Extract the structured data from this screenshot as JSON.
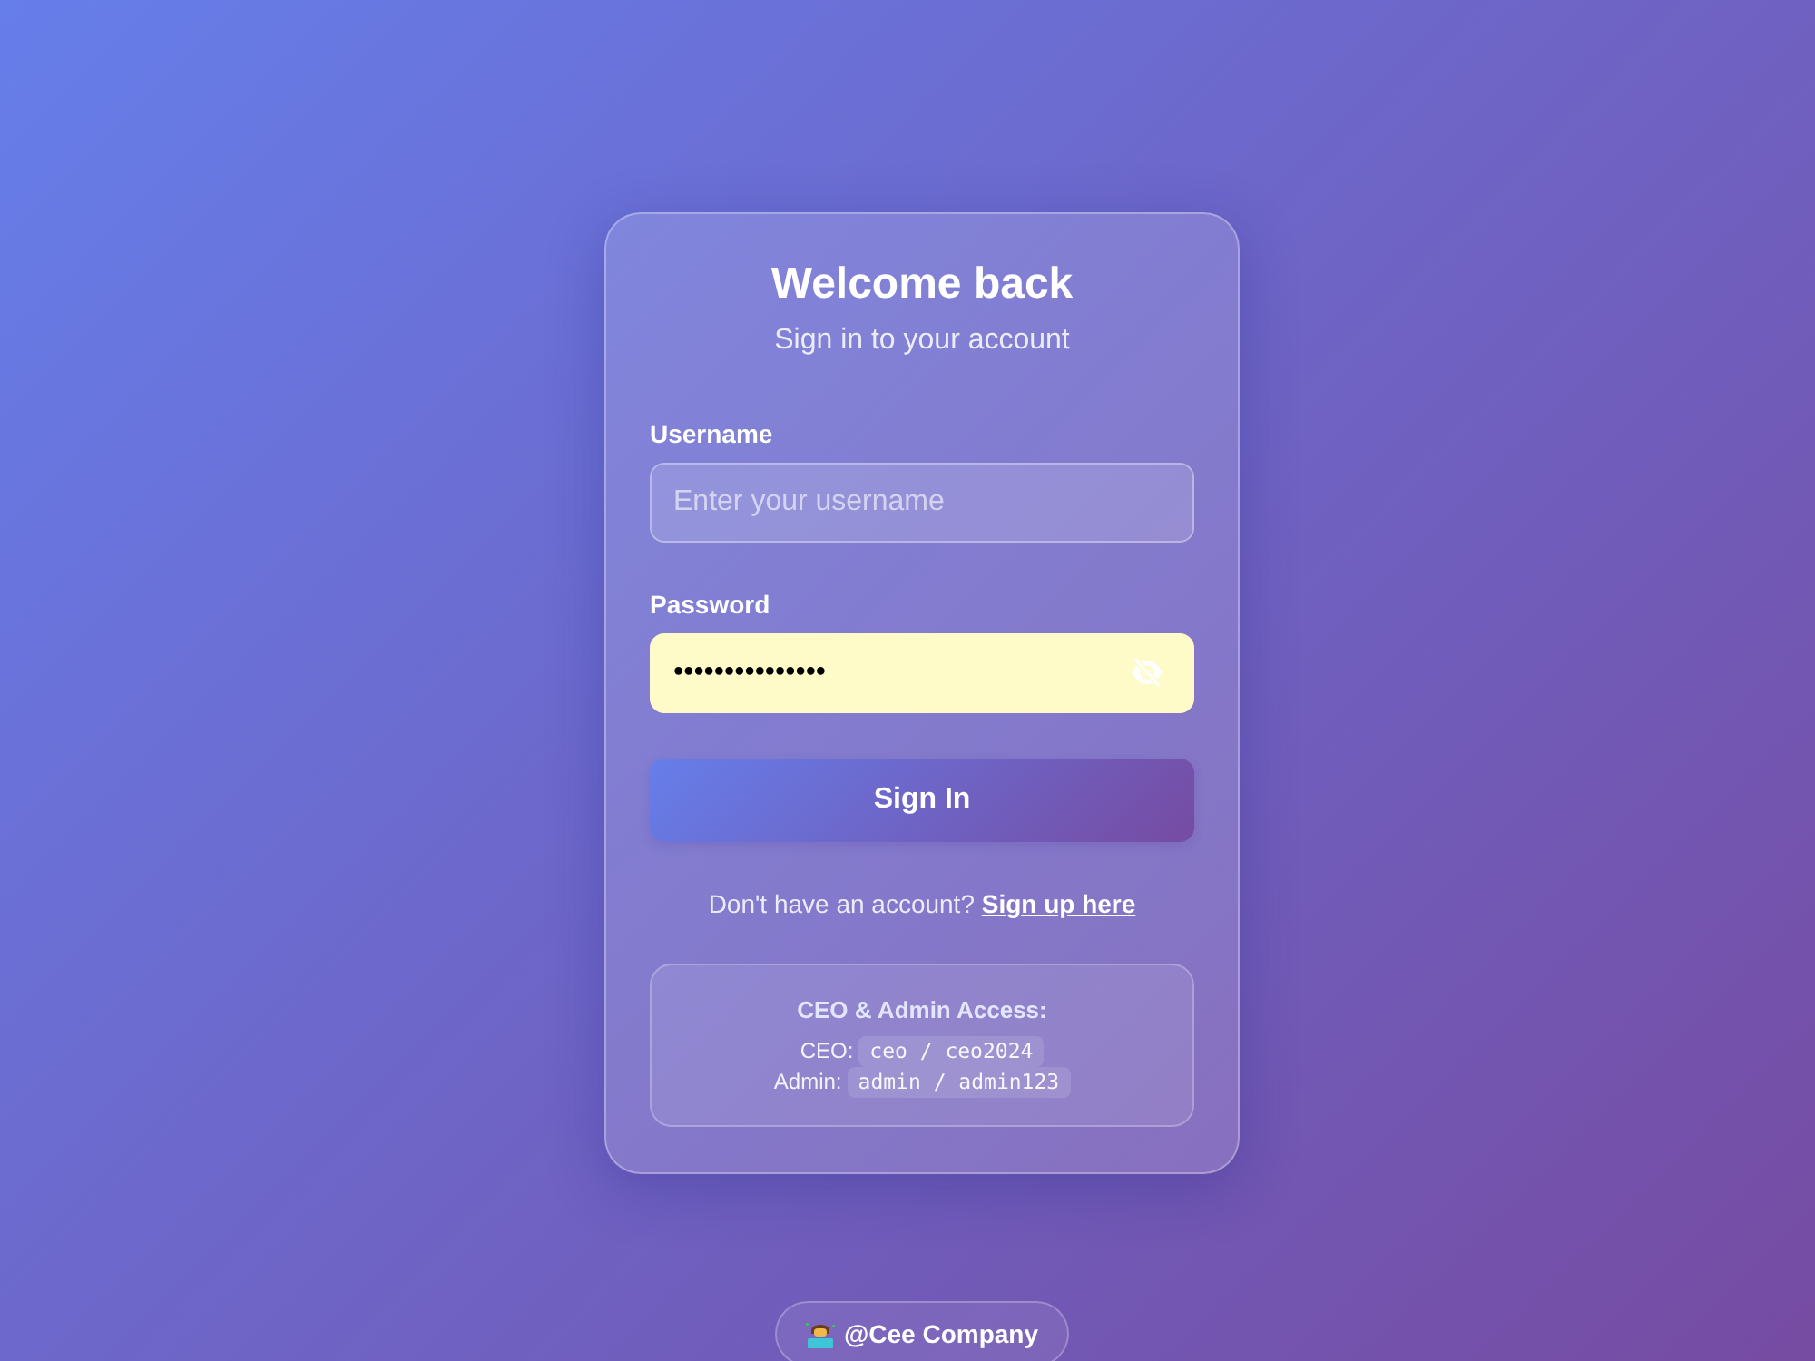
{
  "card": {
    "title": "Welcome back",
    "subtitle": "Sign in to your account"
  },
  "fields": [
    {
      "kind": "text",
      "label": "Username",
      "placeholder": "Enter your username",
      "autofilled": false
    },
    {
      "kind": "password",
      "label": "Password",
      "value": "•••••••••••••••",
      "autofilled": true
    }
  ],
  "submit": {
    "label": "Sign In"
  },
  "signup": {
    "text": "Don't have an account?",
    "link": "Sign up here"
  },
  "credentials": {
    "title": "CEO & Admin Access:",
    "rows": [
      {
        "label": "CEO:",
        "value": "ceo / ceo2024"
      },
      {
        "label": "Admin:",
        "value": "admin / admin123"
      }
    ]
  },
  "footer": {
    "label": "@Cee Company"
  }
}
